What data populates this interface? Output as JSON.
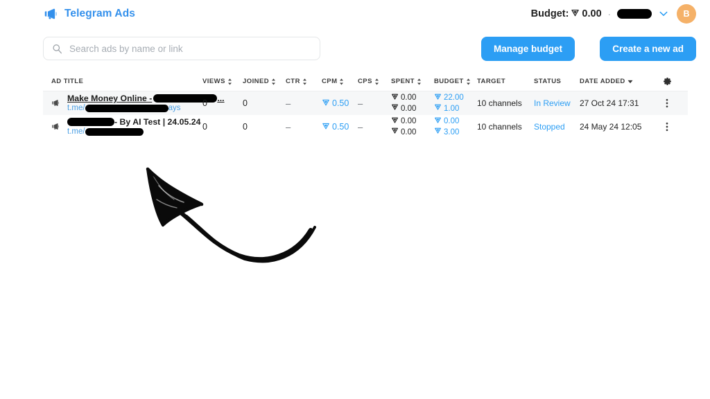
{
  "header": {
    "brand_label": "Telegram Ads",
    "brand_icon": "megaphone-icon",
    "budget_label": "Budget:",
    "budget_currency_icon": "telegram-star-icon",
    "budget_value": "0.00",
    "account_redacted": true,
    "account_chevron_icon": "chevron-down-icon",
    "avatar_initial": "B"
  },
  "toolbar": {
    "search_placeholder": "Search ads by name or link",
    "search_value": "",
    "search_icon": "search-icon",
    "manage_budget_label": "Manage budget",
    "create_ad_label": "Create a new ad"
  },
  "table": {
    "columns": [
      {
        "key": "title",
        "label": "AD TITLE",
        "sortable": false
      },
      {
        "key": "views",
        "label": "VIEWS",
        "sortable": true
      },
      {
        "key": "joined",
        "label": "JOINED",
        "sortable": true
      },
      {
        "key": "ctr",
        "label": "CTR",
        "sortable": true
      },
      {
        "key": "cpm",
        "label": "CPM",
        "sortable": true
      },
      {
        "key": "cps",
        "label": "CPS",
        "sortable": true
      },
      {
        "key": "spent",
        "label": "SPENT",
        "sortable": true
      },
      {
        "key": "budget",
        "label": "BUDGET",
        "sortable": true
      },
      {
        "key": "target",
        "label": "TARGET",
        "sortable": false
      },
      {
        "key": "status",
        "label": "STATUS",
        "sortable": false
      },
      {
        "key": "date",
        "label": "DATE ADDED",
        "sortable": true,
        "sorted": "desc"
      }
    ],
    "settings_icon": "gear-icon",
    "rows": [
      {
        "icon": "megaphone-icon",
        "title_prefix": "Make Money Online - ",
        "title_redacted": true,
        "title_suffix": "...",
        "link_prefix": "t.me/",
        "link_redacted": true,
        "link_suffix": "ays",
        "views": "0",
        "joined": "0",
        "ctr": "–",
        "cpm_icon": "telegram-star-icon",
        "cpm": "0.50",
        "cps": "–",
        "spent_line1": "0.00",
        "spent_line2": "0.00",
        "budget_line1": "22.00",
        "budget_line2": "1.00",
        "target": "10 channels",
        "status": "In Review",
        "date_added": "27 Oct 24 17:31",
        "menu_icon": "kebab-menu-icon",
        "highlighted": true
      },
      {
        "icon": "megaphone-icon",
        "title_prefix": "",
        "title_redacted": true,
        "title_suffix": " - By AI Test | 24.05.24",
        "link_prefix": "t.me/",
        "link_redacted": true,
        "link_suffix": "",
        "views": "0",
        "joined": "0",
        "ctr": "–",
        "cpm_icon": "telegram-star-icon",
        "cpm": "0.50",
        "cps": "–",
        "spent_line1": "0.00",
        "spent_line2": "0.00",
        "budget_line1": "0.00",
        "budget_line2": "3.00",
        "target": "10 channels",
        "status": "Stopped",
        "date_added": "24 May 24 12:05",
        "menu_icon": "kebab-menu-icon",
        "highlighted": false
      }
    ]
  },
  "annotation": {
    "type": "hand-drawn-arrow",
    "points_to": "ad-rows-table"
  },
  "colors": {
    "accent_blue": "#2c9ef4",
    "brand_blue": "#3390ec",
    "avatar_orange": "#f5b168",
    "row_highlight": "#f6f7f8",
    "text_dark": "#1f1f1f"
  }
}
